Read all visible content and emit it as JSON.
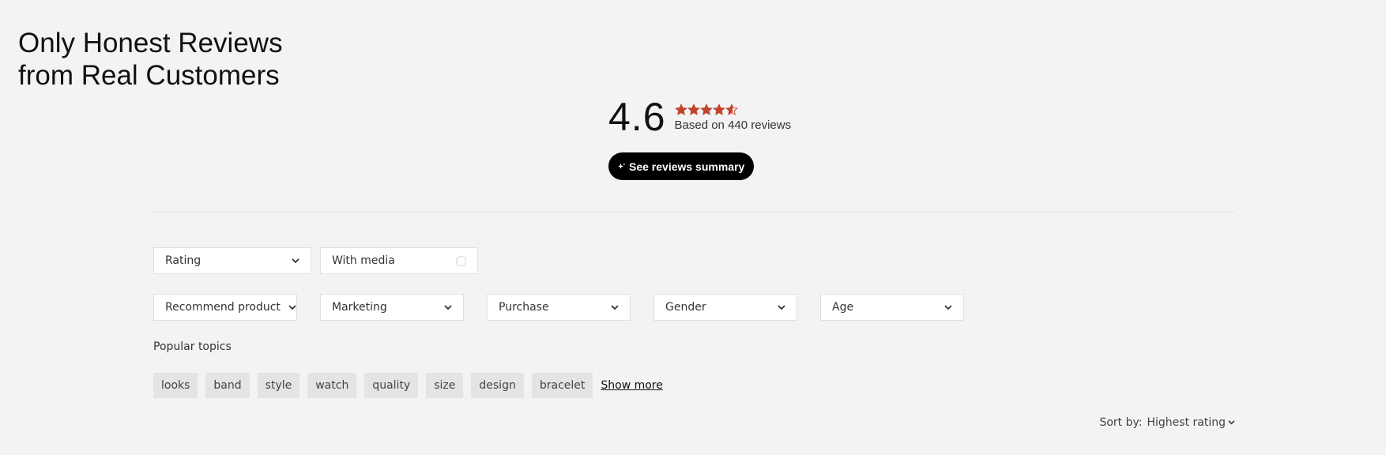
{
  "heading": {
    "line1": "Only Honest Reviews",
    "line2": "from Real Customers"
  },
  "rating": {
    "average": "4.6",
    "stars_value": 4.6,
    "stars_max": 5,
    "based_on": "Based on 440 reviews",
    "star_color": "#c0432b"
  },
  "summary_button": {
    "label": "See reviews summary",
    "icon": "sparkle-icon"
  },
  "filters": {
    "row1": [
      {
        "label": "Rating",
        "kind": "dropdown",
        "icon": "chevron-down-icon"
      },
      {
        "label": "With media",
        "kind": "toggle",
        "icon": "radio-circle-icon"
      }
    ],
    "row2": [
      {
        "label": "Recommend product",
        "kind": "dropdown",
        "icon": "chevron-down-icon"
      },
      {
        "label": "Marketing",
        "kind": "dropdown",
        "icon": "chevron-down-icon"
      },
      {
        "label": "Purchase",
        "kind": "dropdown",
        "icon": "chevron-down-icon"
      },
      {
        "label": "Gender",
        "kind": "dropdown",
        "icon": "chevron-down-icon"
      },
      {
        "label": "Age",
        "kind": "dropdown",
        "icon": "chevron-down-icon"
      }
    ]
  },
  "topics": {
    "label": "Popular topics",
    "items": [
      "looks",
      "band",
      "style",
      "watch",
      "quality",
      "size",
      "design",
      "bracelet"
    ],
    "show_more": "Show more"
  },
  "sort": {
    "prefix": "Sort by:",
    "value": "Highest rating",
    "icon": "chevron-down-icon"
  },
  "colors": {
    "background": "#f3f3f3",
    "button_bg": "#000000",
    "chip_bg": "#e4e4e4",
    "star": "#c0432b"
  }
}
